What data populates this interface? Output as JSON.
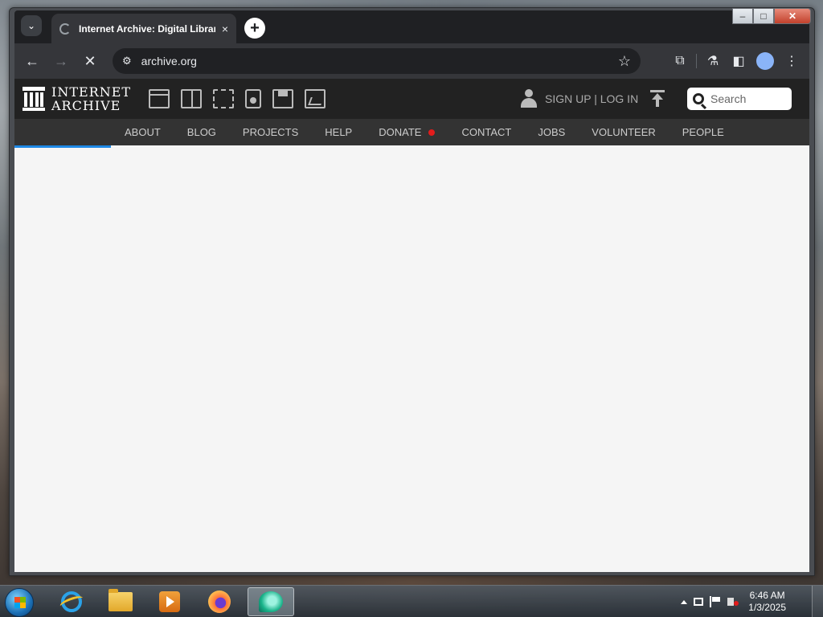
{
  "browser": {
    "tab_title": "Internet Archive: Digital Library of Free & Borrowable Books, Movies, Music & Wayback Machine",
    "tab_close": "×",
    "new_tab": "+",
    "url": "archive.org",
    "window_controls": {
      "minimize": "–",
      "maximize": "□",
      "close": "✕"
    }
  },
  "site": {
    "logo_line1": "INTERNET",
    "logo_line2": "ARCHIVE",
    "media_icons": [
      "web-icon",
      "texts-icon",
      "video-icon",
      "audio-icon",
      "software-icon",
      "images-icon"
    ],
    "auth_text": "SIGN UP | LOG IN",
    "search_placeholder": "Search",
    "nav": {
      "about": "ABOUT",
      "blog": "BLOG",
      "projects": "PROJECTS",
      "help": "HELP",
      "donate": "DONATE",
      "contact": "CONTACT",
      "jobs": "JOBS",
      "volunteer": "VOLUNTEER",
      "people": "PEOPLE"
    },
    "colors": {
      "topnav_bg": "#222222",
      "subnav_bg": "#333333",
      "donate_dot": "#e21c1c",
      "loading_bar": "#1e88e5"
    }
  },
  "taskbar": {
    "time": "6:46 AM",
    "date": "1/3/2025",
    "apps": [
      "internet-explorer",
      "file-explorer",
      "media-player",
      "firefox",
      "chrome"
    ]
  }
}
